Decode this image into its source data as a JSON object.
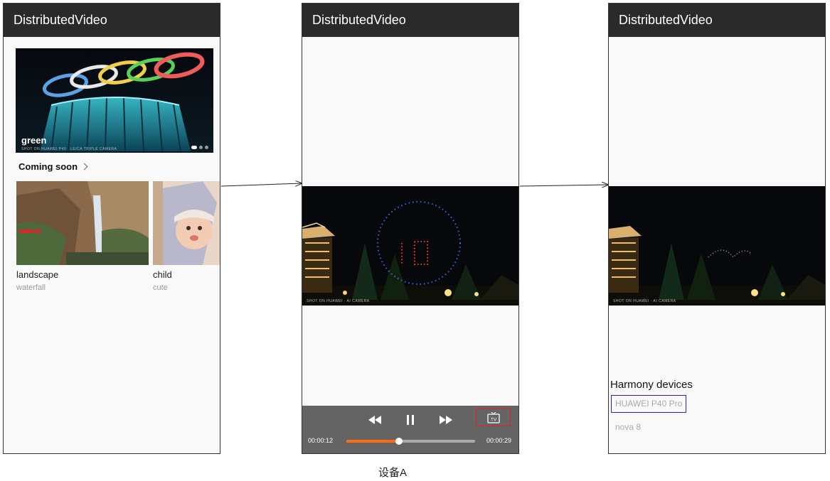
{
  "app_title": "DistributedVideo",
  "screen1": {
    "banner": {
      "label": "green",
      "sub": "SHOT ON HUAWEI P40 · LEICA TRIPLE CAMERA",
      "page_count": 3,
      "active_page": 1
    },
    "section_title": "Coming soon",
    "cards": [
      {
        "title": "landscape",
        "subtitle": "waterfall"
      },
      {
        "title": "child",
        "subtitle": "cute"
      }
    ]
  },
  "screen2": {
    "video_watermark": "SHOT ON HUAWEI · AI CAMERA",
    "current_time": "00:00:12",
    "total_time": "00:00:29",
    "progress": 0.41,
    "cast_label": "TV"
  },
  "screen3": {
    "video_watermark": "SHOT ON HUAWEI · AI CAMERA",
    "devices_title": "Harmony devices",
    "devices": [
      {
        "name": "HUAWEI P40 Pro",
        "selected": true
      },
      {
        "name": "nova 8",
        "selected": false
      }
    ]
  },
  "caption": "设备A",
  "colors": {
    "titlebar": "#2a2a2a",
    "progress": "#ff6a13",
    "cast_highlight": "#e52222",
    "device_highlight": "#2626a8"
  }
}
